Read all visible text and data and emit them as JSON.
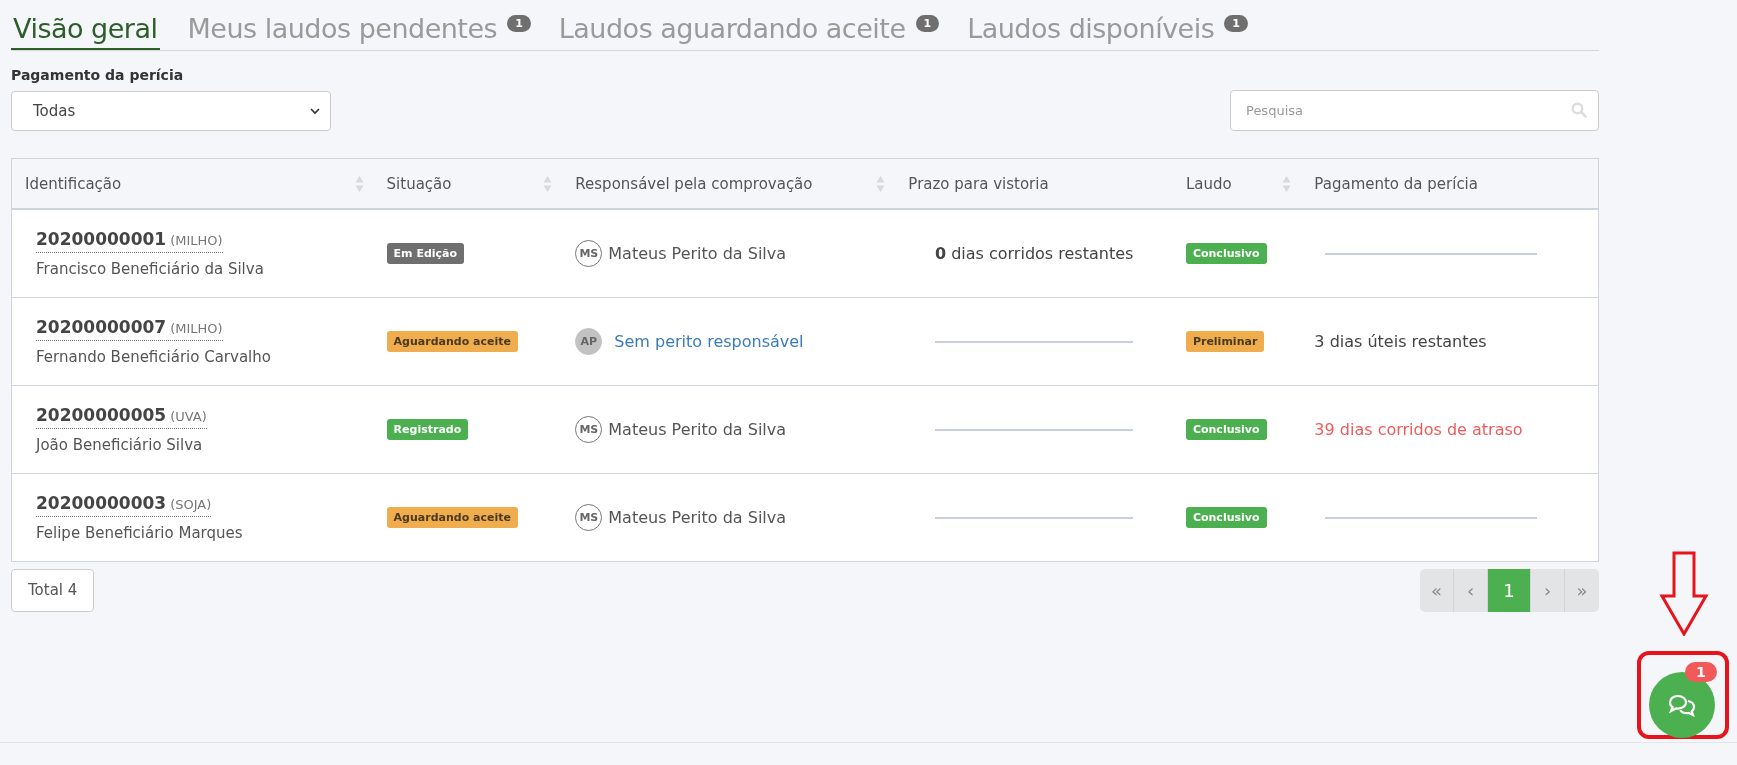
{
  "tabs": [
    {
      "label": "Visão geral",
      "selected": true
    },
    {
      "label": "Meus laudos pendentes",
      "selected": false,
      "badge": "1"
    },
    {
      "label": "Laudos aguardando aceite",
      "selected": false,
      "badge": "1"
    },
    {
      "label": "Laudos disponíveis",
      "selected": false,
      "badge": "1"
    }
  ],
  "filter": {
    "label": "Pagamento da perícia",
    "value": "Todas"
  },
  "search": {
    "placeholder": "Pesquisa"
  },
  "table": {
    "columns": [
      {
        "label": "Identificação",
        "sortable": true
      },
      {
        "label": "Situação",
        "sortable": true
      },
      {
        "label": "Responsável pela comprovação",
        "sortable": true
      },
      {
        "label": "Prazo para vistoria",
        "sortable": false
      },
      {
        "label": "Laudo",
        "sortable": true
      },
      {
        "label": "Pagamento da perícia",
        "sortable": false
      }
    ],
    "rows": [
      {
        "id": "20200000001",
        "crop": "(MILHO)",
        "name": "Francisco Beneficiário da Silva",
        "status": {
          "text": "Em Edição",
          "kind": "dark"
        },
        "responsible": {
          "initials": "MS",
          "name": "Mateus Perito da Silva",
          "assigned": true
        },
        "deadline": {
          "kind": "text",
          "text": "**0** dias corridos restantes"
        },
        "report": {
          "text": "Conclusivo",
          "kind": "success"
        },
        "payment": {
          "kind": "dash"
        }
      },
      {
        "id": "20200000007",
        "crop": "(MILHO)",
        "name": "Fernando Beneficiário Carvalho",
        "status": {
          "text": "Aguardando aceite",
          "kind": "warning"
        },
        "responsible": {
          "initials": "AP",
          "name": "Sem perito responsável",
          "assigned": false
        },
        "deadline": {
          "kind": "dash"
        },
        "report": {
          "text": "Preliminar",
          "kind": "warning"
        },
        "payment": {
          "kind": "text",
          "text": "3 dias úteis restantes",
          "late": false
        }
      },
      {
        "id": "20200000005",
        "crop": "(UVA)",
        "name": "João Beneficiário Silva",
        "status": {
          "text": "Registrado",
          "kind": "success"
        },
        "responsible": {
          "initials": "MS",
          "name": "Mateus Perito da Silva",
          "assigned": true
        },
        "deadline": {
          "kind": "dash"
        },
        "report": {
          "text": "Conclusivo",
          "kind": "success"
        },
        "payment": {
          "kind": "text",
          "text": "39 dias corridos de atraso",
          "late": true
        }
      },
      {
        "id": "20200000003",
        "crop": "(SOJA)",
        "name": "Felipe Beneficiário Marques",
        "status": {
          "text": "Aguardando aceite",
          "kind": "warning"
        },
        "responsible": {
          "initials": "MS",
          "name": "Mateus Perito da Silva",
          "assigned": true
        },
        "deadline": {
          "kind": "dash"
        },
        "report": {
          "text": "Conclusivo",
          "kind": "success"
        },
        "payment": {
          "kind": "dash"
        }
      }
    ]
  },
  "total": "Total 4",
  "pagination": [
    {
      "label": "«",
      "selected": false,
      "disabled": true
    },
    {
      "label": "‹",
      "selected": false,
      "disabled": true
    },
    {
      "label": "1",
      "selected": true,
      "disabled": false
    },
    {
      "label": "›",
      "selected": false,
      "disabled": true
    },
    {
      "label": "»",
      "selected": false,
      "disabled": true
    }
  ],
  "chat": {
    "badge": "1"
  }
}
